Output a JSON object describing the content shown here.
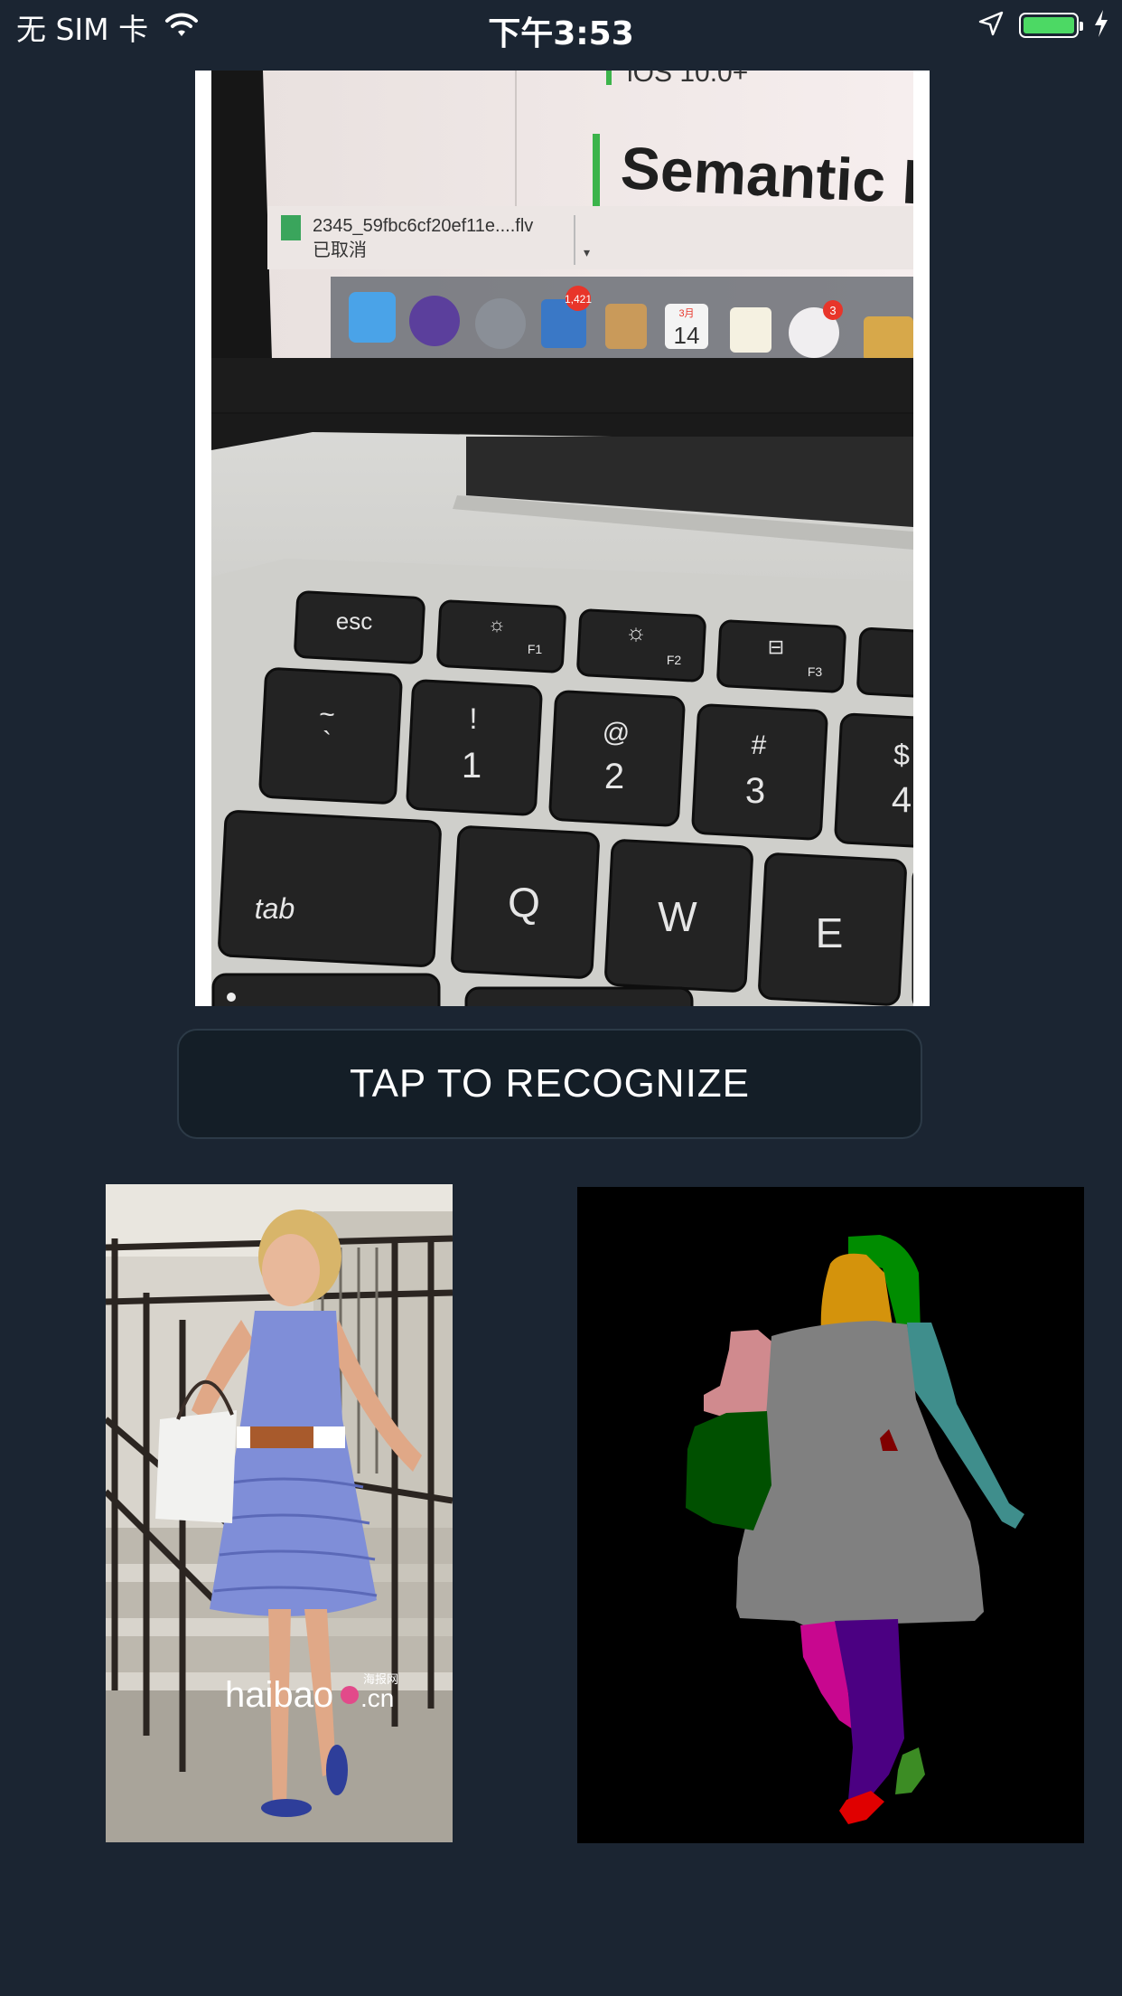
{
  "status_bar": {
    "carrier": "无 SIM 卡",
    "time": "下午3:53",
    "battery_level": 1.0,
    "icons": [
      "wifi-icon",
      "location-arrow-icon",
      "battery-icon",
      "charging-bolt-icon"
    ]
  },
  "main_photo": {
    "screen_text": {
      "ios_version": "iOS 10.0+",
      "heading": "Semantic la",
      "download_file": "2345_59fbc6cf20ef11e....flv",
      "download_status": "已取消",
      "calendar_month": "3月",
      "calendar_day": "14",
      "mail_badge": "1,421",
      "photos_badge": "3"
    },
    "keys": {
      "esc": "esc",
      "f1": "F1",
      "f2": "F2",
      "f3": "F3",
      "tilde_top": "~",
      "tilde_bottom": "`",
      "one_top": "!",
      "one_bottom": "1",
      "two_top": "@",
      "two_bottom": "2",
      "three_top": "#",
      "three_bottom": "3",
      "four_top": "$",
      "four_bottom": "4",
      "tab": "tab",
      "q": "Q",
      "w": "W",
      "e": "E"
    }
  },
  "recognize_button": {
    "label": "TAP TO RECOGNIZE"
  },
  "input_photo": {
    "watermark_main": "haibao",
    "watermark_suffix": ".cn",
    "watermark_cn": "海报网"
  },
  "segmentation": {
    "colors": {
      "background": "#000000",
      "hair": "#008c00",
      "face": "#d4930c",
      "dress": "#808080",
      "left_arm": "#d08a8e",
      "right_arm": "#3f8e8c",
      "bag": "#005000",
      "belt": "#800000",
      "left_leg": "#c8078f",
      "right_leg": "#4b0082",
      "left_shoe": "#e00000",
      "right_shoe": "#3c8c24"
    }
  },
  "accent_colors": {
    "app_background": "#1b2532",
    "button_background": "#141e27",
    "battery_fill": "#4cd964"
  }
}
